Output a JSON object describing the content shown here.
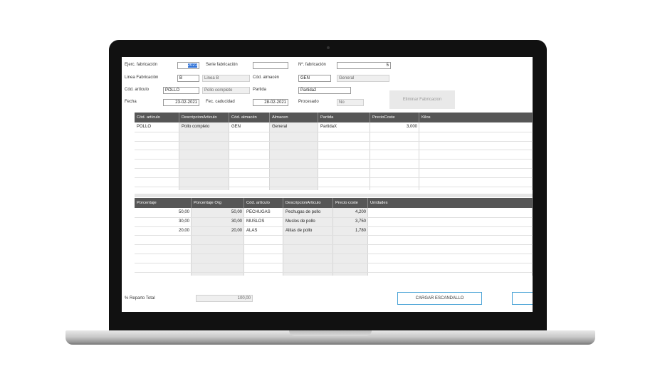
{
  "form": {
    "ejerc_label": "Ejerc. fabricación",
    "ejerc_value": "2021",
    "serie_label": "Serie fabricación",
    "serie_value": "",
    "num_label": "Nº. fabricación",
    "num_value": "5",
    "linea_label": "Linea Fabricación",
    "linea_value": "B",
    "linea_desc": "Linea B",
    "almacen_label": "Cód. almacén",
    "almacen_value": "GEN",
    "almacen_desc": "General",
    "articulo_label": "Cód. artículo",
    "articulo_value": "POLLO",
    "articulo_desc": "Pollo completo",
    "partida_label": "Partida",
    "partida_value": "Partida2",
    "fecha_label": "Fecha",
    "fecha_value": "23-02-2021",
    "caducidad_label": "Fec. caducidad",
    "caducidad_value": "28-02-2021",
    "procesado_label": "Procesado",
    "procesado_value": "No",
    "eliminar_label": "Eliminar Fabricacion"
  },
  "grid1": {
    "headers": [
      "Cód. artículo",
      "DescripcionArticulo",
      "Cód. almacén",
      "Almacen",
      "Partida",
      "PrecioCoste",
      "Kilos"
    ],
    "rows": [
      [
        "POLLO",
        "Pollo completo",
        "GEN",
        "General",
        "PartidaX",
        "3,000",
        ""
      ]
    ]
  },
  "grid2": {
    "headers": [
      "Porcentaje",
      "Porcentaje Org",
      "Cód. artículo",
      "DescripcionArticulo",
      "Precio coste",
      "Unidades"
    ],
    "rows": [
      [
        "50,00",
        "50,00",
        "PECHUGAS",
        "Pechugas de pollo",
        "4,200",
        ""
      ],
      [
        "30,00",
        "30,00",
        "MUSLOS",
        "Muslos de pollo",
        "3,750",
        ""
      ],
      [
        "20,00",
        "20,00",
        "ALAS",
        "Alitas de pollo",
        "1,780",
        ""
      ]
    ]
  },
  "footer": {
    "reparto_label": "% Reparto Total",
    "reparto_value": "100,00",
    "cargar_label": "CARGAR ESCANDALLO"
  }
}
